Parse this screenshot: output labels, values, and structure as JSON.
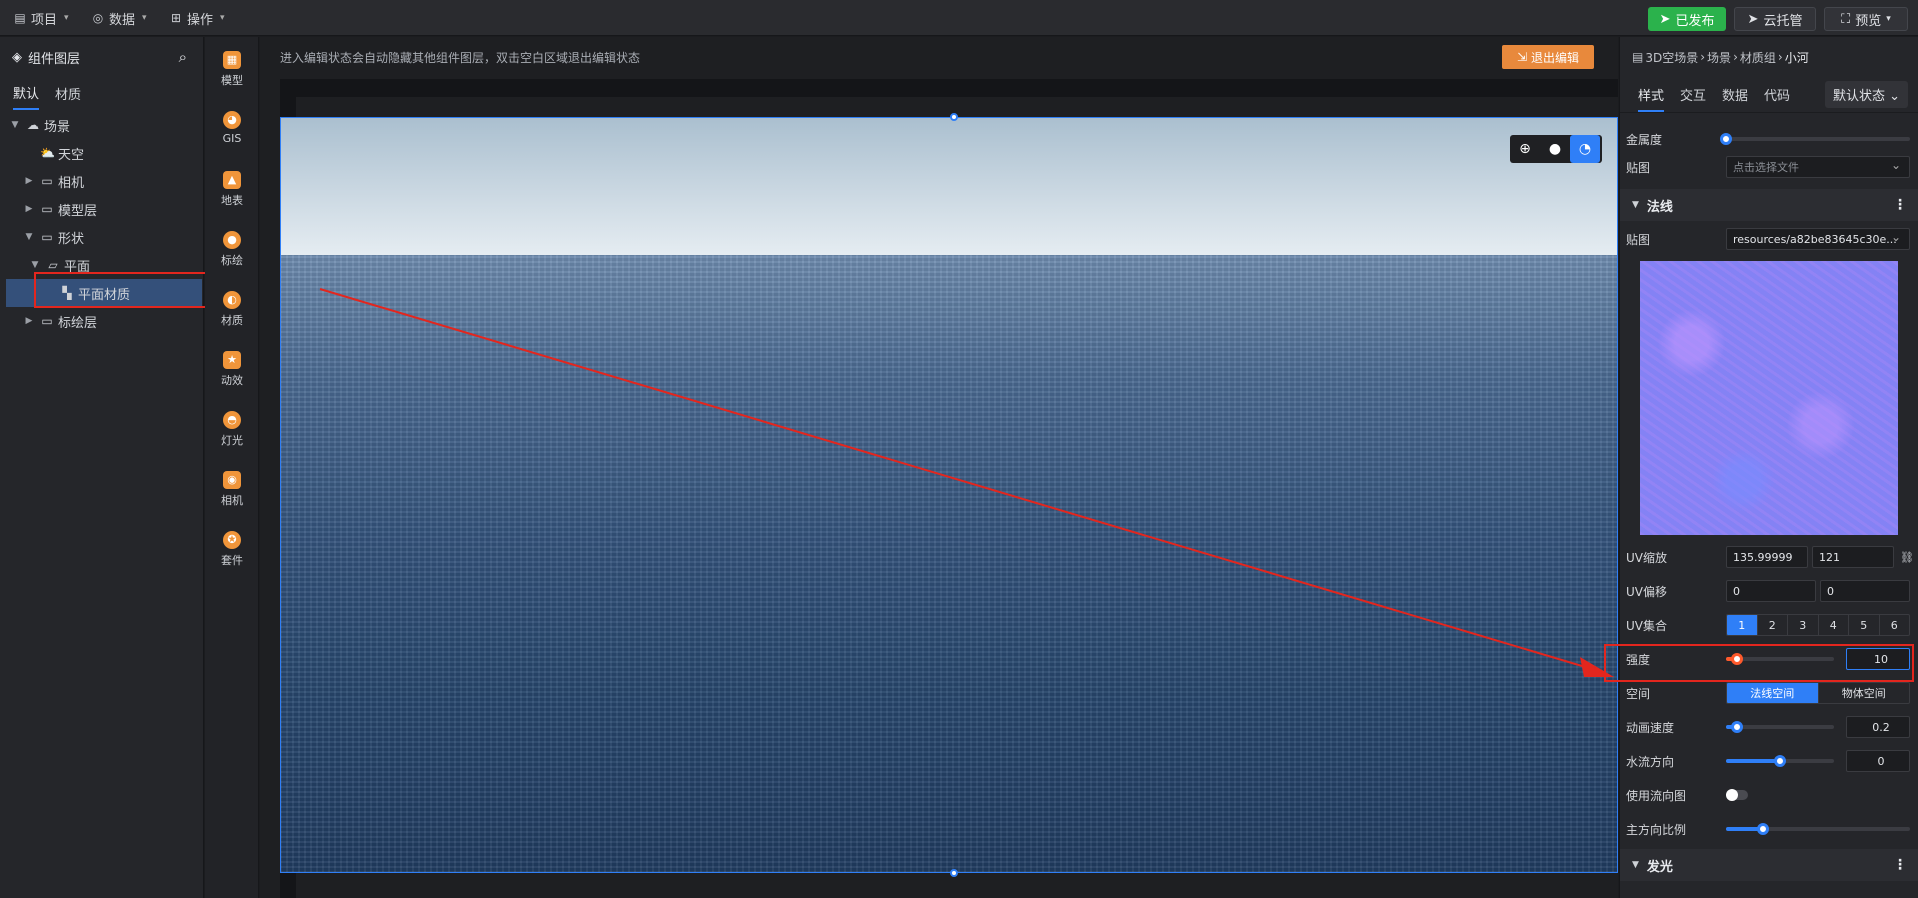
{
  "topbar": {
    "menus": [
      {
        "label": "项目",
        "icon": "file-icon"
      },
      {
        "label": "数据",
        "icon": "database-icon"
      },
      {
        "label": "操作",
        "icon": "grid-icon"
      }
    ],
    "publish_label": "已发布",
    "hosting_label": "云托管",
    "preview_label": "预览",
    "accent": "#2f7ff7",
    "publish_color": "#2bb24c"
  },
  "layers": {
    "title": "组件图层",
    "tabs": [
      "默认",
      "材质"
    ],
    "tree": [
      {
        "label": "场景",
        "level": 0,
        "expanded": true,
        "icon": "cloud-icon"
      },
      {
        "label": "天空",
        "level": 1,
        "icon": "sun-cloud-icon"
      },
      {
        "label": "相机",
        "level": 1,
        "collapsed": true,
        "icon": "folder-icon"
      },
      {
        "label": "模型层",
        "level": 1,
        "collapsed": true,
        "icon": "folder-icon"
      },
      {
        "label": "形状",
        "level": 1,
        "expanded": true,
        "icon": "folder-icon"
      },
      {
        "label": "平面",
        "level": 2,
        "expanded": true,
        "icon": "plane-icon"
      },
      {
        "label": "平面材质",
        "level": 3,
        "selected": true,
        "icon": "checker-icon"
      },
      {
        "label": "标绘层",
        "level": 1,
        "collapsed": true,
        "icon": "folder-icon"
      }
    ]
  },
  "tools": [
    {
      "label": "模型",
      "icon": "model-icon"
    },
    {
      "label": "GIS",
      "icon": "gis-icon"
    },
    {
      "label": "地表",
      "icon": "terrain-icon"
    },
    {
      "label": "标绘",
      "icon": "pin-icon"
    },
    {
      "label": "材质",
      "icon": "material-icon"
    },
    {
      "label": "动效",
      "icon": "effect-icon"
    },
    {
      "label": "灯光",
      "icon": "light-icon"
    },
    {
      "label": "相机",
      "icon": "camera-icon"
    },
    {
      "label": "套件",
      "icon": "kit-icon"
    }
  ],
  "canvas": {
    "hint": "进入编辑状态会自动隐藏其他组件图层，双击空白区域退出编辑状态",
    "exit_label": "退出编辑"
  },
  "inspector": {
    "breadcrumb": [
      "3D空场景",
      "场景",
      "材质组",
      "小河"
    ],
    "tabs": [
      "样式",
      "交互",
      "数据",
      "代码"
    ],
    "state_label": "默认状态",
    "metalness_label": "金属度",
    "metalness": 0,
    "texture_label": "贴图",
    "texture_placeholder": "点击选择文件",
    "normal_section": "法线",
    "normal_texture_label": "贴图",
    "normal_texture_value": "resources/a82be83645c30e...",
    "uv_scale_label": "UV缩放",
    "uv_scale": [
      "135.99999",
      "121"
    ],
    "uv_offset_label": "UV偏移",
    "uv_offset": [
      "0",
      "0"
    ],
    "uv_set_label": "UV集合",
    "uv_set_options": [
      "1",
      "2",
      "3",
      "4",
      "5",
      "6"
    ],
    "uv_set_selected": 0,
    "strength_label": "强度",
    "strength_value": "10",
    "strength_fraction": 0.1,
    "space_label": "空间",
    "space_options": [
      "法线空间",
      "物体空间"
    ],
    "space_selected": 0,
    "anim_speed_label": "动画速度",
    "anim_speed": "0.2",
    "anim_speed_fraction": 0.1,
    "flow_dir_label": "水流方向",
    "flow_dir": "0",
    "flow_dir_fraction": 0.5,
    "use_flowmap_label": "使用流向图",
    "use_flowmap": false,
    "main_ratio_label": "主方向比例",
    "main_ratio_fraction": 0.2,
    "glow_section": "发光"
  }
}
